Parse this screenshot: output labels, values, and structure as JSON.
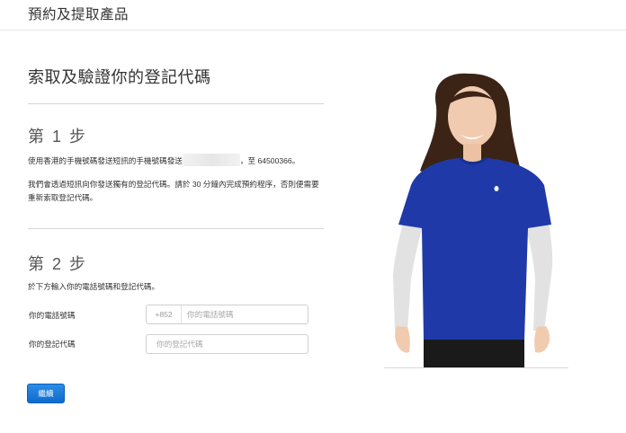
{
  "header": {
    "title": "預約及提取產品"
  },
  "main": {
    "title": "索取及驗證你的登記代碼"
  },
  "step1": {
    "title": "第 1 步",
    "instruction_before": "使用香港的手機號碼發送短訊的手機號碼發送",
    "instruction_after": "，至 64500366。",
    "note": "我們會透過短訊向你發送獨有的登記代碼。請於 30 分鐘內完成預約程序，否則便需要重新索取登記代碼。"
  },
  "step2": {
    "title": "第 2 步",
    "instruction": "於下方輸入你的電話號碼和登記代碼。",
    "phone_label": "你的電話號碼",
    "phone_prefix": "+852",
    "phone_placeholder": "你的電話號碼",
    "code_label": "你的登記代碼",
    "code_placeholder": "你的登記代碼"
  },
  "actions": {
    "continue_label": "繼續"
  },
  "colors": {
    "accent": "#0e6bcf",
    "shirt": "#1f3aa8"
  }
}
